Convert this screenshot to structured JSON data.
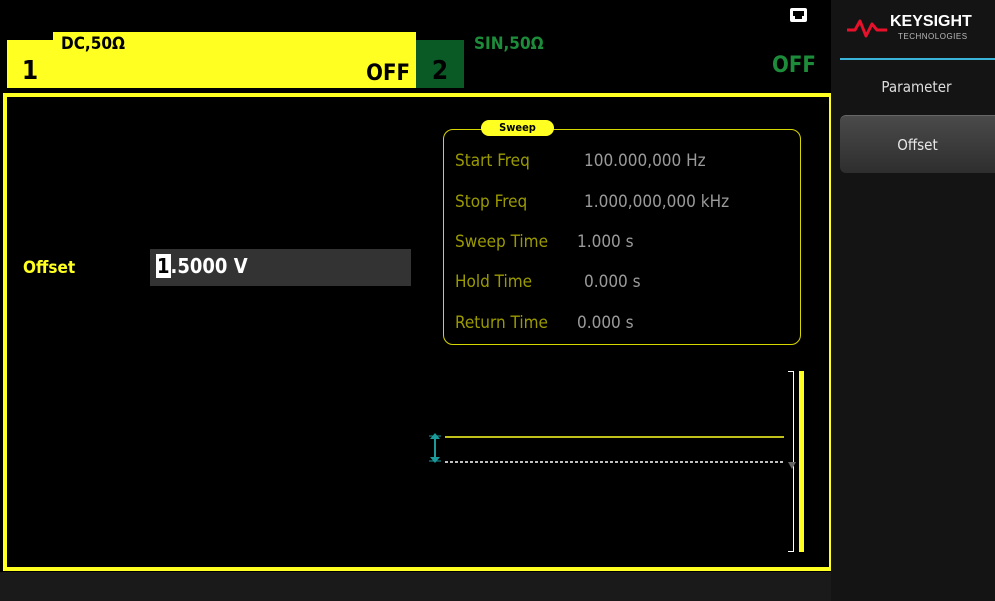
{
  "status": {
    "lan_icon": "lan-icon"
  },
  "channel1": {
    "number": "1",
    "description": "DC,50Ω",
    "output": "OFF"
  },
  "channel2": {
    "number": "2",
    "description": "SIN,50Ω",
    "output": "OFF"
  },
  "parameter": {
    "label": "Offset",
    "value_first_digit": "1",
    "value_rest": ".5000 V"
  },
  "sweep": {
    "title": "Sweep",
    "rows": [
      {
        "label": "Start Freq",
        "value": "100.000,000  Hz"
      },
      {
        "label": "Stop Freq",
        "value": "1.000,000,000 kHz"
      },
      {
        "label": "Sweep Time",
        "value": "1.000  s"
      },
      {
        "label": "Hold Time",
        "value": "0.000  s"
      },
      {
        "label": "Return Time",
        "value": "0.000  s"
      }
    ]
  },
  "brand": {
    "name": "KEYSIGHT",
    "sub": "TECHNOLOGIES"
  },
  "menu": {
    "title": "Parameter",
    "softkeys": [
      "Offset"
    ]
  },
  "colors": {
    "active": "#ffff22",
    "inactive_channel": "#1d8c3a",
    "menu_accent": "#3ab4d8"
  }
}
